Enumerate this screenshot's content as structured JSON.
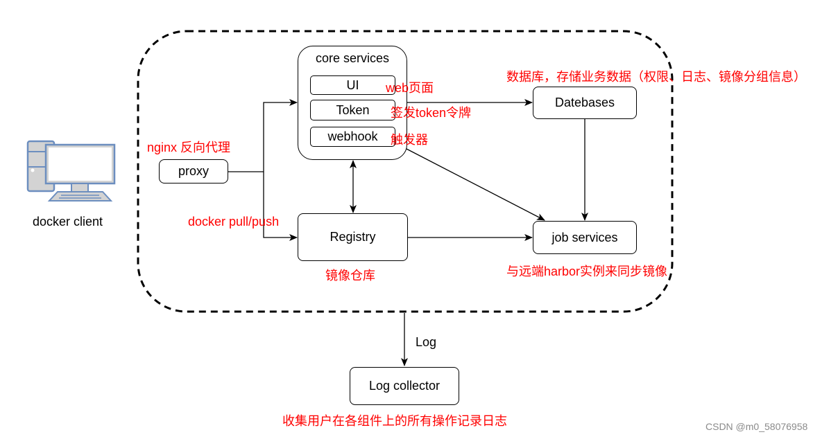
{
  "diagram": {
    "client": {
      "label": "docker client",
      "icon": "computer-icon"
    },
    "proxy": {
      "label": "proxy",
      "note": "nginx 反向代理"
    },
    "pull_push_note": "docker pull/push",
    "core": {
      "title": "core services",
      "items": [
        {
          "label": "UI",
          "note": "web页面"
        },
        {
          "label": "Token",
          "note": "签发token令牌"
        },
        {
          "label": "webhook",
          "note": "触发器"
        }
      ]
    },
    "databases": {
      "label": "Datebases",
      "note": "数据库，存储业务数据（权限、日志、镜像分组信息）"
    },
    "registry": {
      "label": "Registry",
      "note": "镜像仓库"
    },
    "job_services": {
      "label": "job services",
      "note": "与远端harbor实例来同步镜像"
    },
    "log_edge_label": "Log",
    "log_collector": {
      "label": "Log collector",
      "note": "收集用户在各组件上的所有操作记录日志"
    },
    "colors": {
      "annotation": "#ff0000",
      "stroke": "#000000",
      "icon_stroke": "#6c8ebf",
      "icon_fill": "#d3d3d3"
    }
  },
  "watermark": "CSDN @m0_58076958"
}
